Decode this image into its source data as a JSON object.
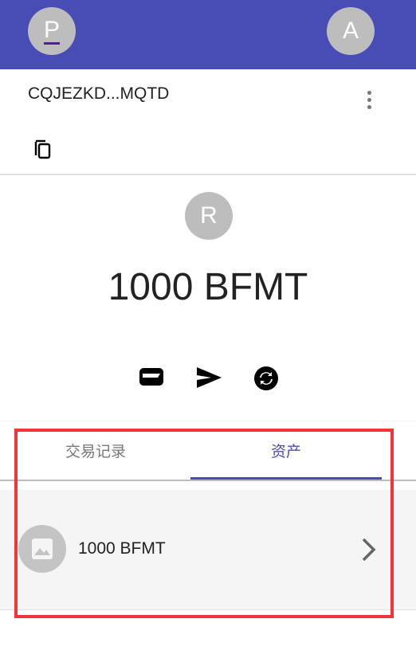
{
  "header": {
    "left_avatar": "P",
    "right_avatar": "A",
    "color": "#474db5"
  },
  "account": {
    "address": "CQJEZKD...MQTD"
  },
  "wallet": {
    "avatar": "R",
    "balance": "1000 BFMT"
  },
  "actions": [
    "wallet-icon",
    "send-icon",
    "exchange-icon"
  ],
  "tabs": [
    {
      "label": "交易记录",
      "active": false
    },
    {
      "label": "资产",
      "active": true
    }
  ],
  "assets": [
    {
      "label": "1000 BFMT"
    }
  ],
  "highlight_color": "#f2343b"
}
